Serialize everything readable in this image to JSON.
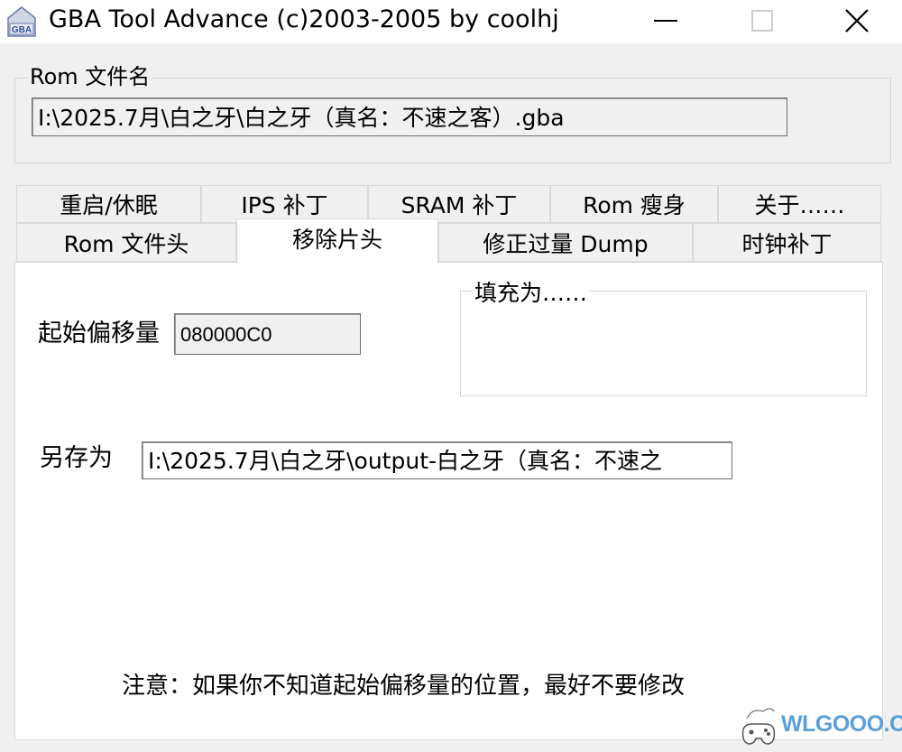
{
  "window": {
    "title": "GBA Tool Advance (c)2003-2005 by coolhj",
    "icon": "gba-app-icon",
    "controls": {
      "minimize_icon": "minimize-icon",
      "maximize_icon": "maximize-icon",
      "close_icon": "close-icon"
    }
  },
  "rom": {
    "label": "Rom 文件名",
    "path": "I:\\2025.7月\\白之牙\\白之牙（真名：不速之客）.gba"
  },
  "tabs": {
    "row1": [
      "重启/休眠",
      "IPS 补丁",
      "SRAM 补丁",
      "Rom 瘦身",
      "关于……"
    ],
    "row2": [
      "Rom 文件头",
      "移除片头",
      "修正过量 Dump",
      "时钟补丁"
    ],
    "active": "移除片头"
  },
  "panel": {
    "offset_label": "起始偏移量",
    "offset_value": "080000C0",
    "fill_label": "填充为……",
    "saveas_label": "另存为",
    "saveas_path": "I:\\2025.7月\\白之牙\\output-白之牙（真名：不速之",
    "note": "注意：如果你不知道起始偏移量的位置，最好不要修改"
  },
  "watermark": {
    "text": "WLGOOO.COM"
  },
  "colors": {
    "window_bg": "#f0f0f0",
    "panel_bg": "#ffffff",
    "border": "#d9d9d9",
    "watermark": "#5aa0d8"
  }
}
